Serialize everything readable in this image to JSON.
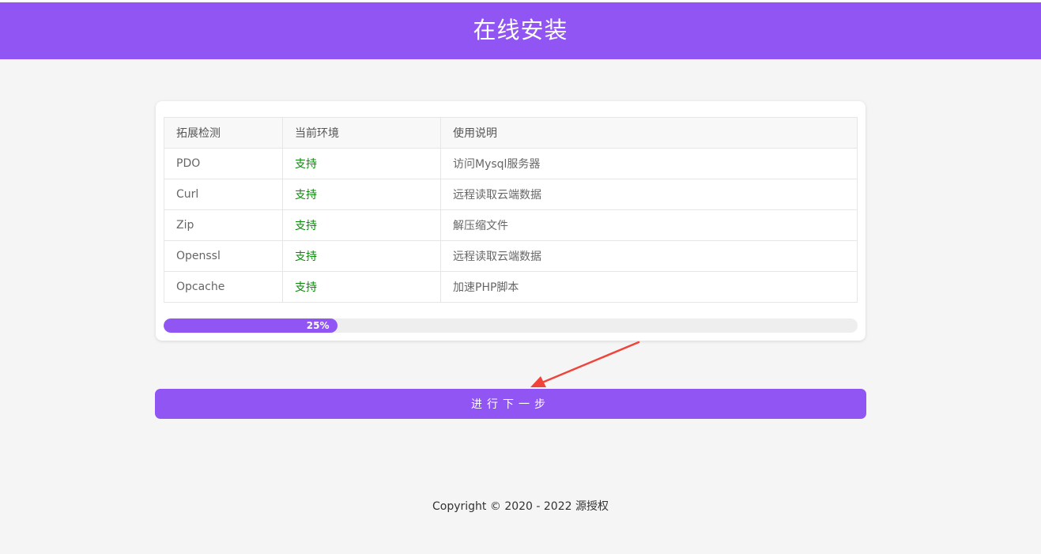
{
  "header": {
    "title": "在线安装"
  },
  "table": {
    "headers": [
      "拓展检测",
      "当前环境",
      "使用说明"
    ],
    "rows": [
      [
        "PDO",
        "支持",
        "访问Mysql服务器"
      ],
      [
        "Curl",
        "支持",
        "远程读取云端数据"
      ],
      [
        "Zip",
        "支持",
        "解压缩文件"
      ],
      [
        "Openssl",
        "支持",
        "远程读取云端数据"
      ],
      [
        "Opcache",
        "支持",
        "加速PHP脚本"
      ]
    ]
  },
  "progress": {
    "value": 0.25,
    "label": "25%"
  },
  "next_button": {
    "label": "进行下一步"
  },
  "footer": {
    "text": "Copyright © 2020 - 2022 源授权"
  },
  "colors": {
    "accent": "#9155f3",
    "status_ok": "#0a8a0a",
    "annotation_arrow": "#f0433a"
  },
  "icons": {
    "annotation": "arrow-annotation-icon"
  }
}
